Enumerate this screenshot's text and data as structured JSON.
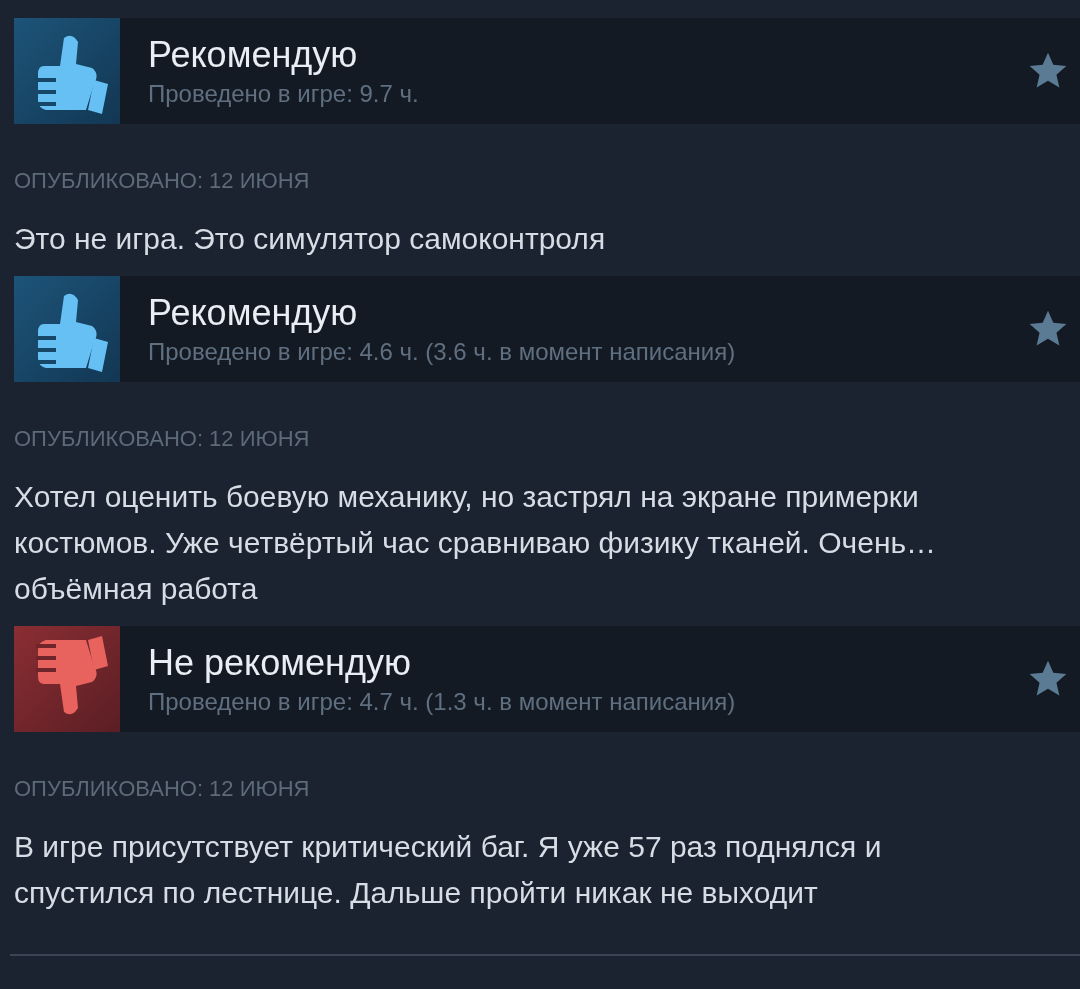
{
  "reviews": [
    {
      "kind": "recommended",
      "verdict": "Рекомендую",
      "hours": "Проведено в игре: 9.7 ч.",
      "posted": "ОПУБЛИКОВАНО: 12 ИЮНЯ",
      "text": "Это не игра. Это симулятор самоконтроля"
    },
    {
      "kind": "recommended",
      "verdict": "Рекомендую",
      "hours": "Проведено в игре: 4.6 ч. (3.6 ч. в момент написания)",
      "posted": "ОПУБЛИКОВАНО: 12 ИЮНЯ",
      "text": "Хотел оценить боевую механику, но застрял на экране примерки костюмов. Уже четвёртый час сравниваю физику тканей. Очень… объёмная работа"
    },
    {
      "kind": "not_recommended",
      "verdict": "Не рекомендую",
      "hours": "Проведено в игре: 4.7 ч. (1.3 ч. в момент написания)",
      "posted": "ОПУБЛИКОВАНО: 12 ИЮНЯ",
      "text": "В игре присутствует критический баг. Я уже 57 раз поднялся и спустился по лестнице. Дальше пройти никак не выходит"
    }
  ]
}
